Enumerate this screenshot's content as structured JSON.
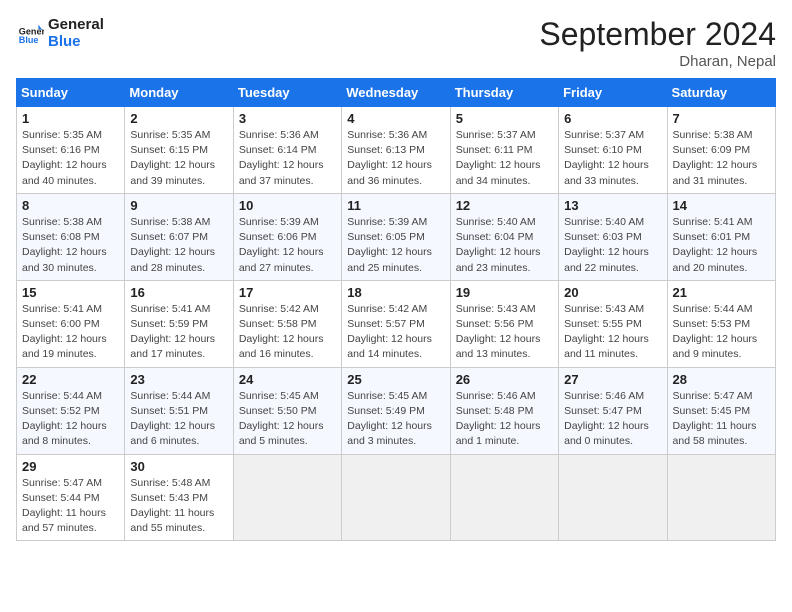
{
  "header": {
    "logo_line1": "General",
    "logo_line2": "Blue",
    "month": "September 2024",
    "location": "Dharan, Nepal"
  },
  "weekdays": [
    "Sunday",
    "Monday",
    "Tuesday",
    "Wednesday",
    "Thursday",
    "Friday",
    "Saturday"
  ],
  "weeks": [
    [
      {
        "day": "1",
        "info": "Sunrise: 5:35 AM\nSunset: 6:16 PM\nDaylight: 12 hours\nand 40 minutes."
      },
      {
        "day": "2",
        "info": "Sunrise: 5:35 AM\nSunset: 6:15 PM\nDaylight: 12 hours\nand 39 minutes."
      },
      {
        "day": "3",
        "info": "Sunrise: 5:36 AM\nSunset: 6:14 PM\nDaylight: 12 hours\nand 37 minutes."
      },
      {
        "day": "4",
        "info": "Sunrise: 5:36 AM\nSunset: 6:13 PM\nDaylight: 12 hours\nand 36 minutes."
      },
      {
        "day": "5",
        "info": "Sunrise: 5:37 AM\nSunset: 6:11 PM\nDaylight: 12 hours\nand 34 minutes."
      },
      {
        "day": "6",
        "info": "Sunrise: 5:37 AM\nSunset: 6:10 PM\nDaylight: 12 hours\nand 33 minutes."
      },
      {
        "day": "7",
        "info": "Sunrise: 5:38 AM\nSunset: 6:09 PM\nDaylight: 12 hours\nand 31 minutes."
      }
    ],
    [
      {
        "day": "8",
        "info": "Sunrise: 5:38 AM\nSunset: 6:08 PM\nDaylight: 12 hours\nand 30 minutes."
      },
      {
        "day": "9",
        "info": "Sunrise: 5:38 AM\nSunset: 6:07 PM\nDaylight: 12 hours\nand 28 minutes."
      },
      {
        "day": "10",
        "info": "Sunrise: 5:39 AM\nSunset: 6:06 PM\nDaylight: 12 hours\nand 27 minutes."
      },
      {
        "day": "11",
        "info": "Sunrise: 5:39 AM\nSunset: 6:05 PM\nDaylight: 12 hours\nand 25 minutes."
      },
      {
        "day": "12",
        "info": "Sunrise: 5:40 AM\nSunset: 6:04 PM\nDaylight: 12 hours\nand 23 minutes."
      },
      {
        "day": "13",
        "info": "Sunrise: 5:40 AM\nSunset: 6:03 PM\nDaylight: 12 hours\nand 22 minutes."
      },
      {
        "day": "14",
        "info": "Sunrise: 5:41 AM\nSunset: 6:01 PM\nDaylight: 12 hours\nand 20 minutes."
      }
    ],
    [
      {
        "day": "15",
        "info": "Sunrise: 5:41 AM\nSunset: 6:00 PM\nDaylight: 12 hours\nand 19 minutes."
      },
      {
        "day": "16",
        "info": "Sunrise: 5:41 AM\nSunset: 5:59 PM\nDaylight: 12 hours\nand 17 minutes."
      },
      {
        "day": "17",
        "info": "Sunrise: 5:42 AM\nSunset: 5:58 PM\nDaylight: 12 hours\nand 16 minutes."
      },
      {
        "day": "18",
        "info": "Sunrise: 5:42 AM\nSunset: 5:57 PM\nDaylight: 12 hours\nand 14 minutes."
      },
      {
        "day": "19",
        "info": "Sunrise: 5:43 AM\nSunset: 5:56 PM\nDaylight: 12 hours\nand 13 minutes."
      },
      {
        "day": "20",
        "info": "Sunrise: 5:43 AM\nSunset: 5:55 PM\nDaylight: 12 hours\nand 11 minutes."
      },
      {
        "day": "21",
        "info": "Sunrise: 5:44 AM\nSunset: 5:53 PM\nDaylight: 12 hours\nand 9 minutes."
      }
    ],
    [
      {
        "day": "22",
        "info": "Sunrise: 5:44 AM\nSunset: 5:52 PM\nDaylight: 12 hours\nand 8 minutes."
      },
      {
        "day": "23",
        "info": "Sunrise: 5:44 AM\nSunset: 5:51 PM\nDaylight: 12 hours\nand 6 minutes."
      },
      {
        "day": "24",
        "info": "Sunrise: 5:45 AM\nSunset: 5:50 PM\nDaylight: 12 hours\nand 5 minutes."
      },
      {
        "day": "25",
        "info": "Sunrise: 5:45 AM\nSunset: 5:49 PM\nDaylight: 12 hours\nand 3 minutes."
      },
      {
        "day": "26",
        "info": "Sunrise: 5:46 AM\nSunset: 5:48 PM\nDaylight: 12 hours\nand 1 minute."
      },
      {
        "day": "27",
        "info": "Sunrise: 5:46 AM\nSunset: 5:47 PM\nDaylight: 12 hours\nand 0 minutes."
      },
      {
        "day": "28",
        "info": "Sunrise: 5:47 AM\nSunset: 5:45 PM\nDaylight: 11 hours\nand 58 minutes."
      }
    ],
    [
      {
        "day": "29",
        "info": "Sunrise: 5:47 AM\nSunset: 5:44 PM\nDaylight: 11 hours\nand 57 minutes."
      },
      {
        "day": "30",
        "info": "Sunrise: 5:48 AM\nSunset: 5:43 PM\nDaylight: 11 hours\nand 55 minutes."
      },
      {
        "day": "",
        "info": ""
      },
      {
        "day": "",
        "info": ""
      },
      {
        "day": "",
        "info": ""
      },
      {
        "day": "",
        "info": ""
      },
      {
        "day": "",
        "info": ""
      }
    ]
  ]
}
